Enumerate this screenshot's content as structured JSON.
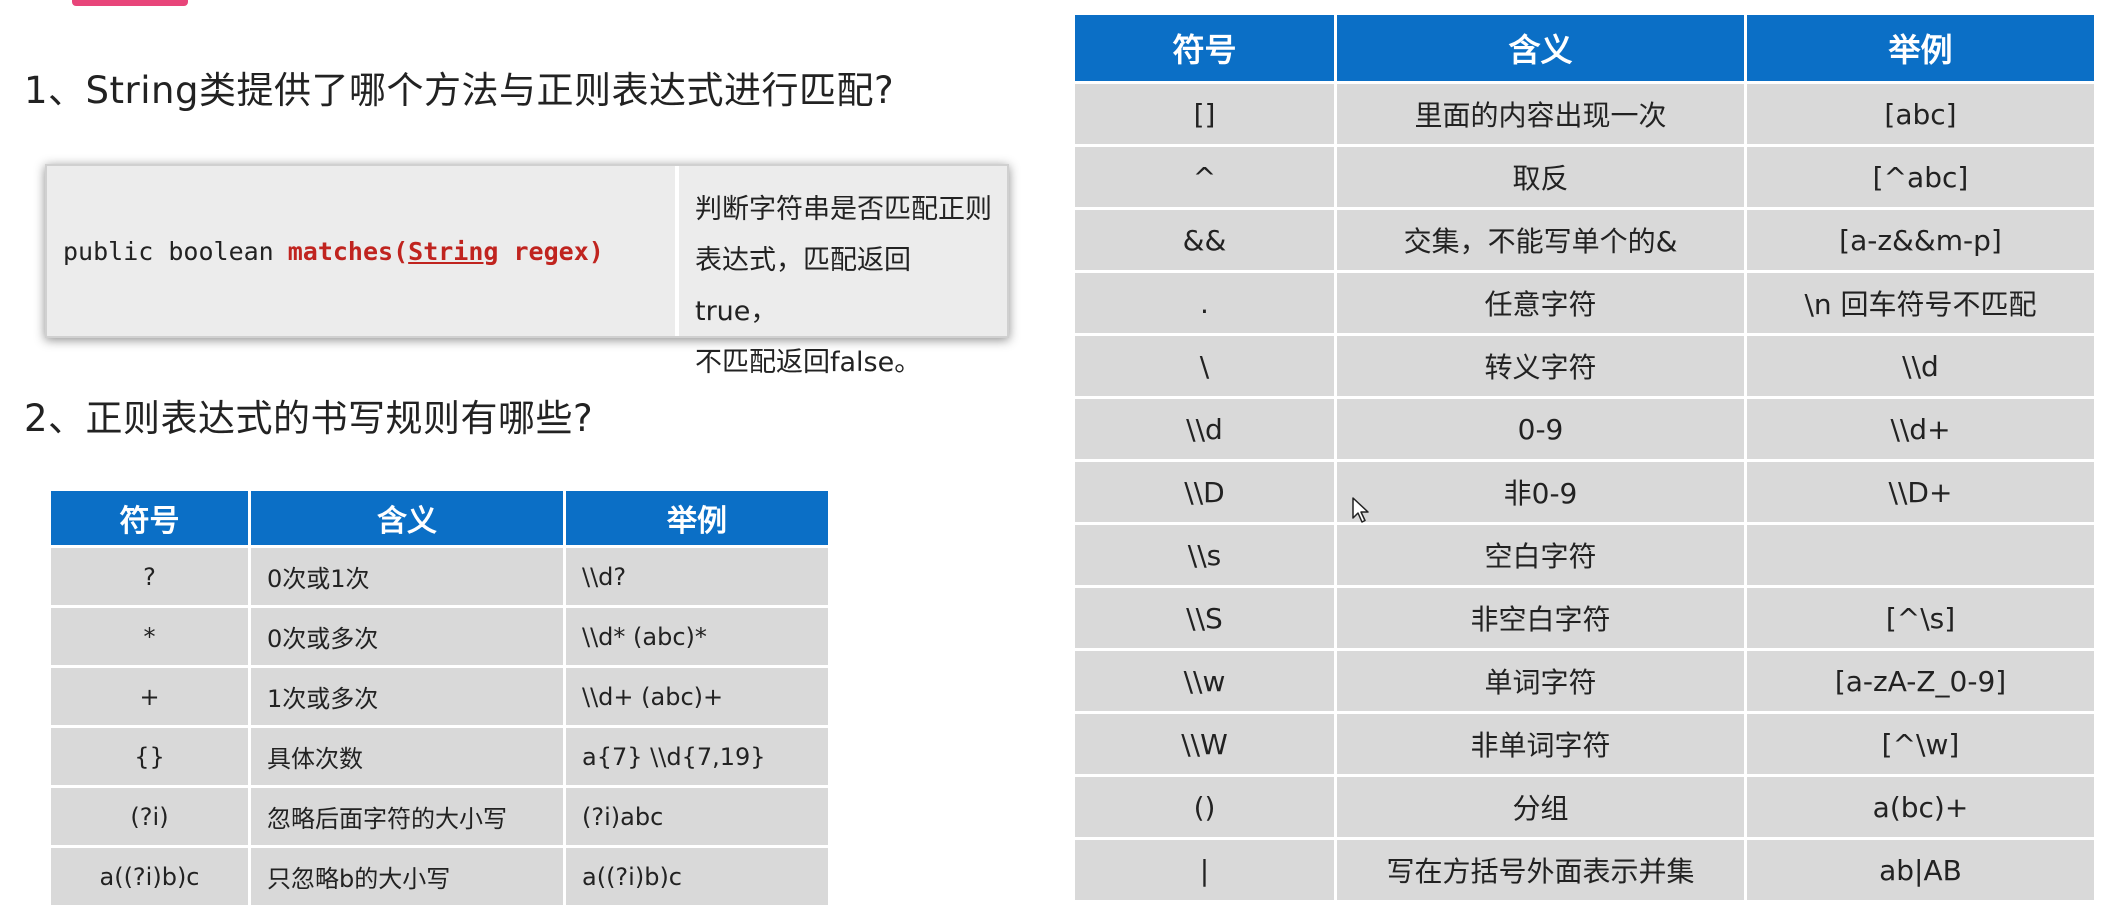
{
  "q1": {
    "text": "1、String类提供了哪个方法与正则表达式进行匹配?"
  },
  "method": {
    "modifiers": "public boolean",
    "name": "matches(",
    "param_type": "String",
    "param_rest": " regex)",
    "desc_lines": [
      "判断字符串是否匹配正则",
      "表达式，匹配返回true，",
      "不匹配返回false。"
    ]
  },
  "q2": {
    "text": "2、正则表达式的书写规则有哪些?"
  },
  "small_table": {
    "headers": [
      "符号",
      "含义",
      "举例"
    ],
    "rows": [
      [
        "?",
        "0次或1次",
        "\\\\d?"
      ],
      [
        "*",
        "0次或多次",
        "\\\\d*      (abc)*"
      ],
      [
        "+",
        "1次或多次",
        "\\\\d+      (abc)+"
      ],
      [
        "{}",
        "具体次数",
        "a{7}        \\\\d{7,19}"
      ],
      [
        "(?i)",
        "忽略后面字符的大小写",
        "(?i)abc"
      ],
      [
        "a((?i)b)c",
        "只忽略b的大小写",
        "a((?i)b)c"
      ]
    ]
  },
  "big_table": {
    "headers": [
      "符号",
      "含义",
      "举例"
    ],
    "rows": [
      [
        "[]",
        "里面的内容出现一次",
        "[abc]"
      ],
      [
        "^",
        "取反",
        "[^abc]"
      ],
      [
        "&&",
        "交集，不能写单个的&",
        "[a-z&&m-p]"
      ],
      [
        ".",
        "任意字符",
        "\\n 回车符号不匹配"
      ],
      [
        "\\",
        "转义字符",
        "\\\\d"
      ],
      [
        "\\\\d",
        "0-9",
        "\\\\d+"
      ],
      [
        "\\\\D",
        "非0-9",
        "\\\\D+"
      ],
      [
        "\\\\s",
        "空白字符",
        ""
      ],
      [
        "\\\\S",
        "非空白字符",
        "[^\\s]"
      ],
      [
        "\\\\w",
        "单词字符",
        "[a-zA-Z_0-9]"
      ],
      [
        "\\\\W",
        "非单词字符",
        "[^\\w]"
      ],
      [
        "()",
        "分组",
        "a(bc)+"
      ],
      [
        "|",
        "写在方括号外面表示并集",
        "ab|AB"
      ]
    ]
  }
}
